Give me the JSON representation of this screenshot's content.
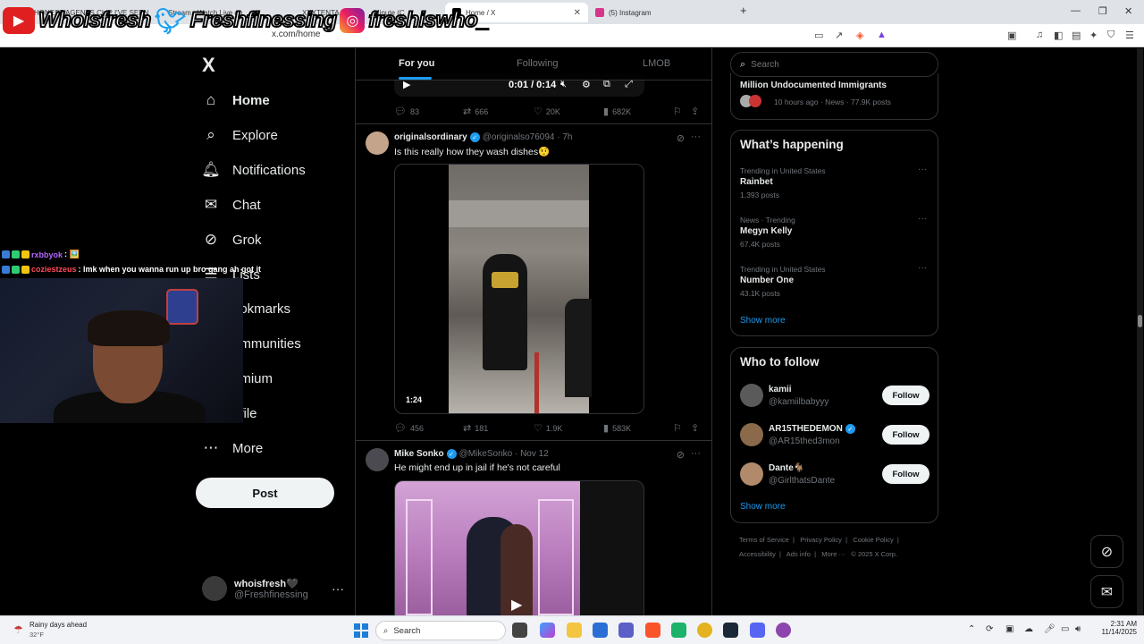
{
  "browser": {
    "tabs": [
      {
        "label": "HONEST AGENTS CLIP I'VE SEEN",
        "active": false
      },
      {
        "label": "Stream - Watch Live on",
        "active": false
      },
      {
        "label": "XXXTENTA",
        "active": false
      },
      {
        "label": "Minute (C",
        "active": false
      },
      {
        "label": "Home / X",
        "active": true
      },
      {
        "label": "(5) Instagram",
        "active": false
      }
    ],
    "new_tab": "+",
    "url": "x.com/home"
  },
  "overlay": {
    "youtube": "Whoisfresh",
    "twitter": "Freshfinessing",
    "instagram": "freshiswho_"
  },
  "chat": [
    {
      "user": "rxbbyok",
      "message": ": 🖼️",
      "color": "#b366ff"
    },
    {
      "user": "coziestzeus",
      "message": ": lmk when you wanna run up bro gang ah got it",
      "color": "#ff4a5a"
    }
  ],
  "nav": {
    "logo": "X",
    "items": [
      {
        "label": "Home",
        "icon": "home-icon",
        "glyph": "⌂",
        "active": true
      },
      {
        "label": "Explore",
        "icon": "search-icon",
        "glyph": "⌕"
      },
      {
        "label": "Notifications",
        "icon": "bell-icon",
        "glyph": "🔔︎"
      },
      {
        "label": "Chat",
        "icon": "envelope-icon",
        "glyph": "✉"
      },
      {
        "label": "Grok",
        "icon": "grok-icon",
        "glyph": "⊘"
      },
      {
        "label": "Lists",
        "icon": "list-icon",
        "glyph": "☰"
      },
      {
        "label": "ookmarks",
        "icon": "bookmark-icon",
        "glyph": "⚑"
      },
      {
        "label": "ommunities",
        "icon": "people-icon",
        "glyph": "⚇"
      },
      {
        "label": "emium",
        "icon": "premium-icon",
        "glyph": "✕"
      },
      {
        "label": "ofile",
        "icon": "person-icon",
        "glyph": "☺"
      },
      {
        "label": "More",
        "icon": "more-circle-icon",
        "glyph": "⋯"
      }
    ],
    "post_label": "Post",
    "profile_name": "whoisfresh🖤",
    "profile_handle": "@Freshfinessing",
    "profile_more": "···"
  },
  "feed": {
    "tabs": [
      "For you",
      "Following",
      "LMOB"
    ],
    "top_video": {
      "time": "0:01 / 0:14"
    },
    "top_actions": {
      "replies": "83",
      "reposts": "666",
      "likes": "20K",
      "views": "682K"
    },
    "tweets": [
      {
        "name": "originalsordinary",
        "handle": "@originalso76094 · 7h",
        "text": "Is this really how they wash dishes🤨",
        "media_time": "1:24",
        "replies": "456",
        "reposts": "181",
        "likes": "1.9K",
        "views": "583K"
      },
      {
        "name": "Mike Sonko",
        "handle": "@MikeSonko · Nov 12",
        "text": "He might end up in jail if he's not careful"
      }
    ]
  },
  "right": {
    "search_placeholder": "Search",
    "top_card": {
      "title": "Million Undocumented Immigrants",
      "meta": "10 hours ago · News · 77.9K posts"
    },
    "happening_title": "What’s happening",
    "trends": [
      {
        "meta": "Trending in United States",
        "name": "Rainbet",
        "posts": "1,393 posts"
      },
      {
        "meta": "News · Trending",
        "name": "Megyn Kelly",
        "posts": "67.4K posts"
      },
      {
        "meta": "Trending in United States",
        "name": "Number One",
        "posts": "43.1K posts"
      }
    ],
    "show_more": "Show more",
    "wtf_title": "Who to follow",
    "follow_label": "Follow",
    "suggestions": [
      {
        "name": "kamii",
        "handle": "@kamiilbabyyy",
        "avatar_color": "#5a5a5a"
      },
      {
        "name": "AR15THEDEMON",
        "handle": "@AR15thed3mon",
        "avatar_color": "#8a6a4a"
      },
      {
        "name": "Dante🐐",
        "handle": "@GirlthatsDante",
        "avatar_color": "#b08a6a"
      }
    ],
    "footer_row1": [
      "Terms of Service",
      "Privacy Policy",
      "Cookie Policy"
    ],
    "footer_row2": [
      "Accessibility",
      "Ads info",
      "More ···",
      "© 2025 X Corp."
    ]
  },
  "taskbar": {
    "weather": "Rainy days ahead",
    "temp": "32°F",
    "search": "Search",
    "time": "2:31 AM",
    "date": "11/14/2025"
  }
}
